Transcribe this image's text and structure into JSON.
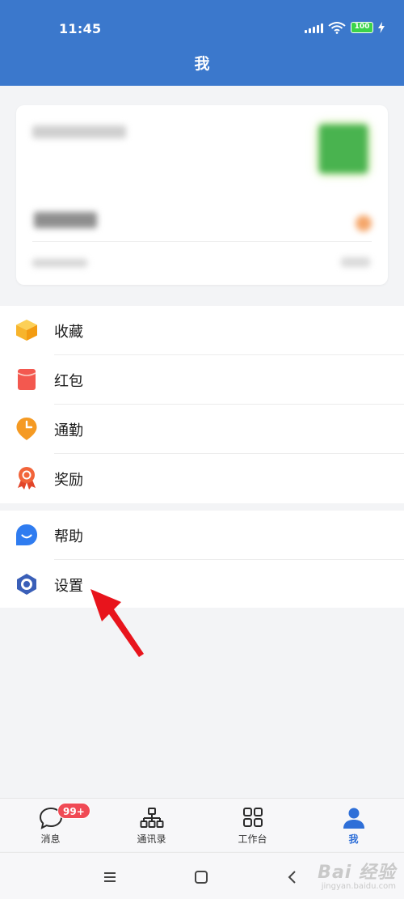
{
  "status_bar": {
    "time": "11:45",
    "battery": "100"
  },
  "header": {
    "title": "我"
  },
  "menu_group_1": [
    {
      "label": "收藏",
      "icon": "box-icon",
      "color": "#f7b42c"
    },
    {
      "label": "红包",
      "icon": "red-envelope-icon",
      "color": "#f3584f"
    },
    {
      "label": "通勤",
      "icon": "clock-pin-icon",
      "color": "#f59a23"
    },
    {
      "label": "奖励",
      "icon": "award-ribbon-icon",
      "color": "#f2643a"
    }
  ],
  "menu_group_2": [
    {
      "label": "帮助",
      "icon": "help-chat-icon",
      "color": "#2f7cf0"
    },
    {
      "label": "设置",
      "icon": "settings-hexagon-icon",
      "color": "#3a5fb8"
    }
  ],
  "tabs": [
    {
      "label": "消息",
      "icon": "chat-bubble-icon",
      "badge": "99+"
    },
    {
      "label": "通讯录",
      "icon": "org-chart-icon"
    },
    {
      "label": "工作台",
      "icon": "grid-icon"
    },
    {
      "label": "我",
      "icon": "person-icon",
      "active": true
    }
  ],
  "watermark": {
    "main": "Bai 经验",
    "sub": "jingyan.baidu.com"
  },
  "colors": {
    "header_bg": "#3b78cc",
    "accent": "#2e6fd8",
    "badge": "#f04a55",
    "annotation_arrow": "#e8141c"
  }
}
